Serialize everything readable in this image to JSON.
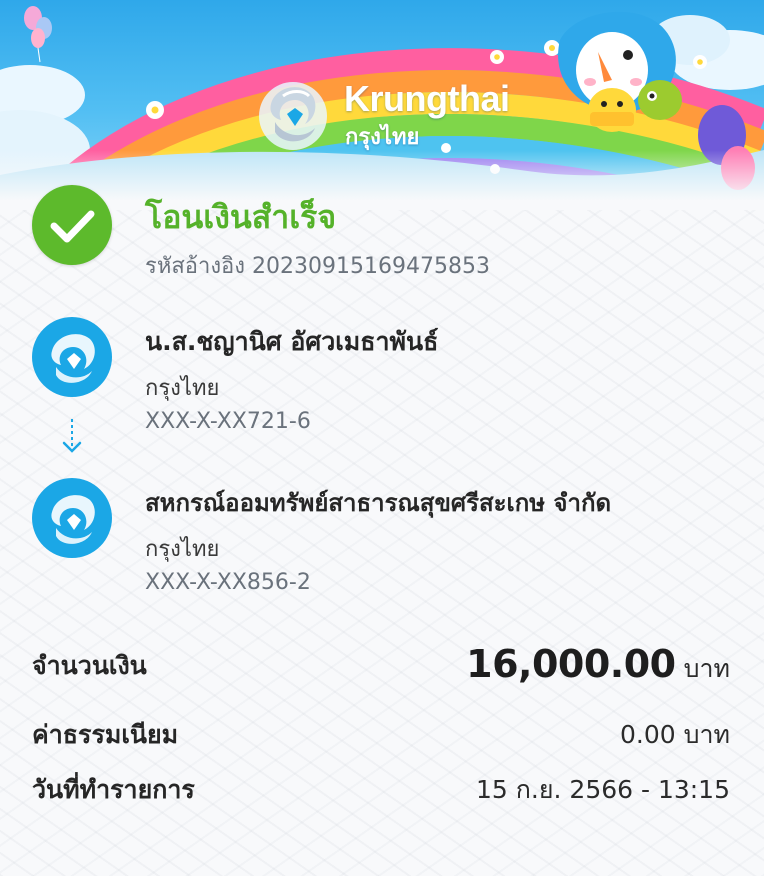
{
  "brand": {
    "name_en": "Krungthai",
    "name_th": "กรุงไทย"
  },
  "status": {
    "title": "โอนเงินสำเร็จ",
    "reference": "รหัสอ้างอิง 20230915169475853"
  },
  "sender": {
    "name": "น.ส.ชญานิศ อัศวเมธาพันธ์",
    "bank": "กรุงไทย",
    "account": "XXX-X-XX721-6"
  },
  "receiver": {
    "name": "สหกรณ์ออมทรัพย์สาธารณสุขศรีสะเกษ จำกัด",
    "bank": "กรุงไทย",
    "account": "XXX-X-XX856-2"
  },
  "details": {
    "amount_label": "จำนวนเงิน",
    "amount_value": "16,000.00",
    "amount_unit": "บาท",
    "fee_label": "ค่าธรรมเนียม",
    "fee_value": "0.00 บาท",
    "date_label": "วันที่ทำรายการ",
    "date_value": "15 ก.ย. 2566 - 13:15"
  },
  "colors": {
    "success": "#55b22a",
    "brand_blue": "#1ba7e6",
    "banner_sky": "#2fa8ea"
  },
  "icons": {
    "status": "check-circle-icon",
    "bank": "krungthai-bird-logo-icon",
    "flow": "arrow-down-dashed-icon"
  }
}
